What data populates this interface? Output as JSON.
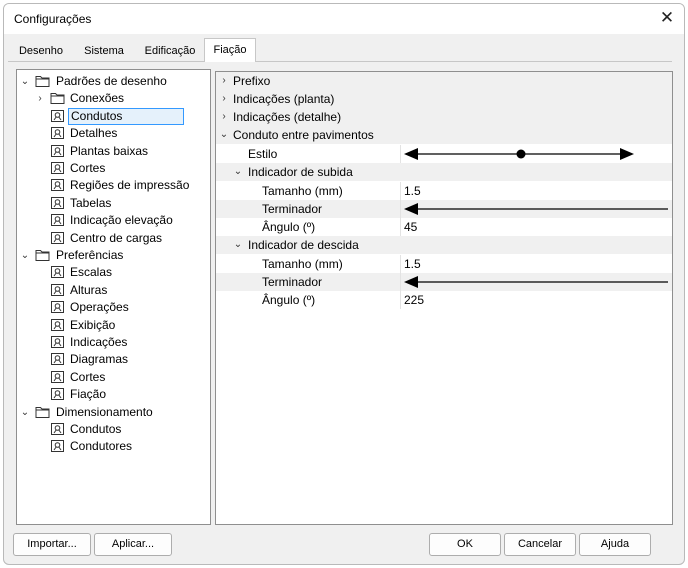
{
  "window": {
    "title": "Configurações"
  },
  "tabs": [
    {
      "label": "Desenho"
    },
    {
      "label": "Sistema"
    },
    {
      "label": "Edificação"
    },
    {
      "label": "Fiação",
      "active": true
    }
  ],
  "tree": {
    "groups": [
      {
        "label": "Padrões de desenho",
        "expanded": true,
        "items": [
          "Conexões",
          "Condutos",
          "Detalhes",
          "Plantas baixas",
          "Cortes",
          "Regiões de impressão",
          "Tabelas",
          "Indicação elevação",
          "Centro de cargas"
        ]
      },
      {
        "label": "Preferências",
        "expanded": true,
        "items": [
          "Escalas",
          "Alturas",
          "Operações",
          "Exibição",
          "Indicações",
          "Diagramas",
          "Cortes",
          "Fiação"
        ]
      },
      {
        "label": "Dimensionamento",
        "expanded": true,
        "items": [
          "Condutos",
          "Condutores"
        ]
      }
    ],
    "selected": "Condutos"
  },
  "properties": {
    "collapsed_categories": [
      "Prefixo",
      "Indicações (planta)",
      "Indicações (detalhe)"
    ],
    "category": "Conduto entre pavimentos",
    "style_label": "Estilo",
    "rise": {
      "label": "Indicador de subida",
      "size_label": "Tamanho (mm)",
      "size_value": "1.5",
      "terminator_label": "Terminador",
      "angle_label": "Ângulo (º)",
      "angle_value": "45"
    },
    "fall": {
      "label": "Indicador de descida",
      "size_label": "Tamanho (mm)",
      "size_value": "1.5",
      "terminator_label": "Terminador",
      "angle_label": "Ângulo (º)",
      "angle_value": "225"
    }
  },
  "buttons": {
    "import": "Importar...",
    "apply": "Aplicar...",
    "ok": "OK",
    "cancel": "Cancelar",
    "help": "Ajuda"
  },
  "icons": {
    "close": "close-icon",
    "folder": "folder-icon",
    "settings_page": "settings-page-icon",
    "expand": "chevron-down-icon",
    "collapse": "chevron-right-icon"
  }
}
